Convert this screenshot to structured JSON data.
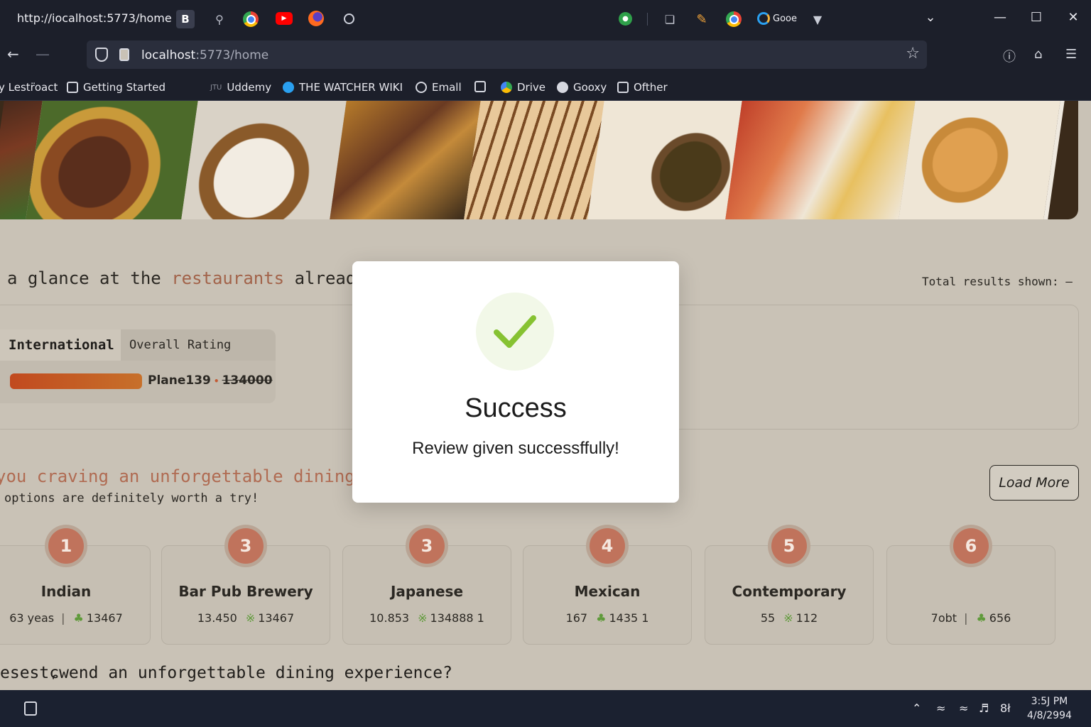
{
  "browser": {
    "tab_url": "http://iocalhost:5773/home",
    "url_host": "localhost",
    "url_path": ":5773/home",
    "tab_icon_b": "B",
    "ext_label": "Gooe",
    "bookmarks": [
      "y Lestr̈oact",
      "Getting Started",
      "Uddemy",
      "THE WATCHER WIKI",
      "Emall",
      "Drive",
      "Gooxy",
      "Ofther"
    ]
  },
  "page": {
    "glance": {
      "prefix": "a glance at the ",
      "highlight": "restaurants",
      "suffix": " already"
    },
    "total_results": "Total results shown: —",
    "filter": {
      "tab_active": "International",
      "tab_other": "Overall Rating",
      "rating_name": "Plane139",
      "rating_dot": "•",
      "rating_value": "134000"
    },
    "craving": "you craving an unforgettable dining es",
    "worth": "options are definitely worth a try!",
    "load_more": "Load More",
    "cards": [
      {
        "badge": "1",
        "name": "Indian",
        "left": "63 yeas",
        "sep": "|",
        "right": "13467"
      },
      {
        "badge": "3",
        "name": "Bar Pub Brewery",
        "left": "13.450",
        "sep": "",
        "right": "13467"
      },
      {
        "badge": "3",
        "name": "Japanese",
        "left": "10.853",
        "sep": "",
        "right": "134888 1"
      },
      {
        "badge": "4",
        "name": "Mexican",
        "left": "167",
        "sep": "",
        "right": "1435 1"
      },
      {
        "badge": "5",
        "name": "Contemporary",
        "left": "55",
        "sep": "",
        "right": "112"
      },
      {
        "badge": "6",
        "name": "",
        "left": "7obt",
        "sep": "|",
        "right": "656"
      }
    ],
    "bottom_question": "esestɕwend an unforgettable dining experience?"
  },
  "modal": {
    "title": "Success",
    "message": "Review given successffully!"
  },
  "taskbar": {
    "time": "3:5J PM",
    "date": "4/8/2994",
    "tray_text": "8ł"
  },
  "colors": {
    "accent": "#b06b52",
    "badge": "#c0735c",
    "success_check": "#86c232",
    "chrome_bg": "#1c1f2a"
  }
}
